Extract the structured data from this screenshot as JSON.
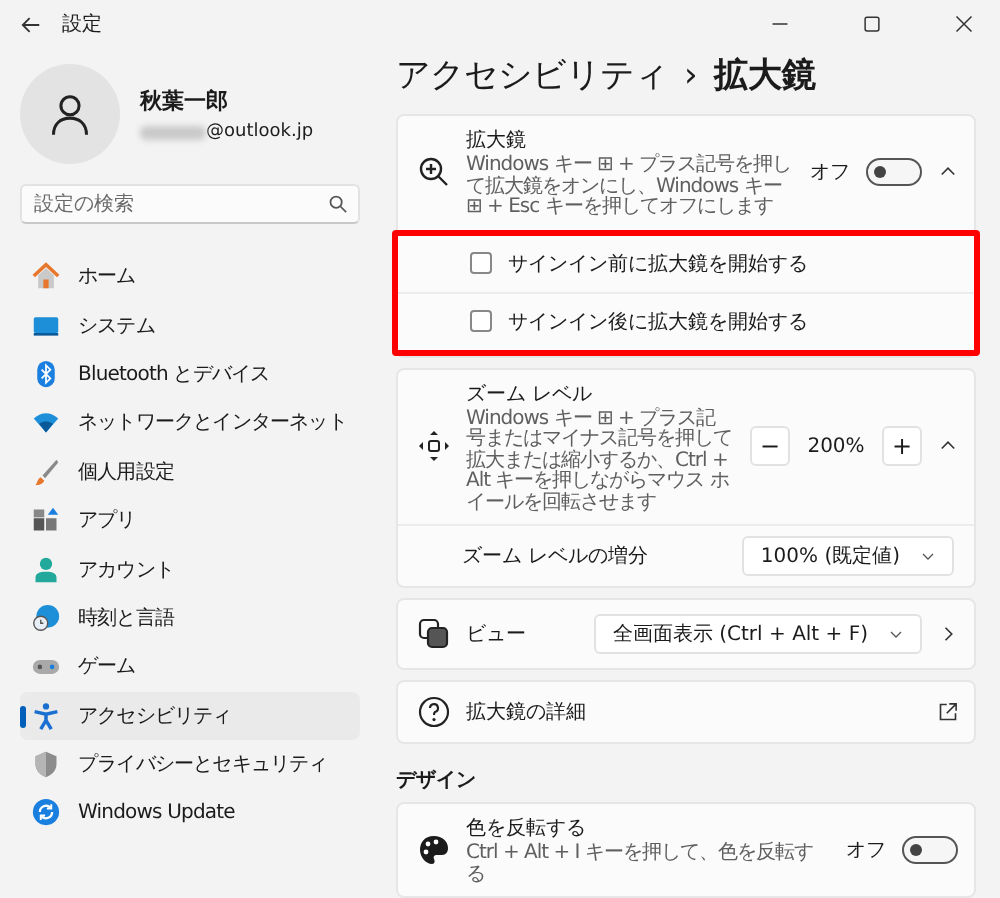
{
  "window": {
    "title": "設定"
  },
  "user": {
    "name": "秋葉一郎",
    "email": "@outlook.jp"
  },
  "search": {
    "placeholder": "設定の検索"
  },
  "sidebar": {
    "items": [
      {
        "label": "ホーム",
        "selected": false
      },
      {
        "label": "システム",
        "selected": false
      },
      {
        "label": "Bluetooth とデバイス",
        "selected": false
      },
      {
        "label": "ネットワークとインターネット",
        "selected": false
      },
      {
        "label": "個人用設定",
        "selected": false
      },
      {
        "label": "アプリ",
        "selected": false
      },
      {
        "label": "アカウント",
        "selected": false
      },
      {
        "label": "時刻と言語",
        "selected": false
      },
      {
        "label": "ゲーム",
        "selected": false
      },
      {
        "label": "アクセシビリティ",
        "selected": true
      },
      {
        "label": "プライバシーとセキュリティ",
        "selected": false
      },
      {
        "label": "Windows Update",
        "selected": false
      }
    ]
  },
  "breadcrumb": {
    "parent": "アクセシビリティ",
    "separator": "›",
    "current": "拡大鏡"
  },
  "magnifier": {
    "title": "拡大鏡",
    "description": "Windows キー ⊞ + プラス記号を押して拡大鏡をオンにし、Windows キー ⊞ + Esc キーを押してオフにします",
    "toggle_label": "オフ",
    "on": false,
    "expanded": true,
    "highlighted": true,
    "options": [
      {
        "label": "サインイン前に拡大鏡を開始する",
        "checked": false
      },
      {
        "label": "サインイン後に拡大鏡を開始する",
        "checked": false
      }
    ]
  },
  "zoom_level": {
    "title": "ズーム レベル",
    "description": "Windows キー ⊞ + プラス記号またはマイナス記号を押して拡大または縮小するか、Ctrl + Alt キーを押しながらマウス ホイールを回転させます",
    "decrease": "−",
    "value": "200%",
    "increase": "+",
    "expanded": true,
    "increment": {
      "label": "ズーム レベルの増分",
      "value": "100% (既定値)"
    }
  },
  "view": {
    "label": "ビュー",
    "value": "全画面表示 (Ctrl + Alt + F)"
  },
  "details": {
    "label": "拡大鏡の詳細"
  },
  "design": {
    "heading": "デザイン",
    "invert": {
      "title": "色を反転する",
      "description": "Ctrl + Alt + I キーを押して、色を反転する",
      "toggle_label": "オフ",
      "on": false
    }
  }
}
